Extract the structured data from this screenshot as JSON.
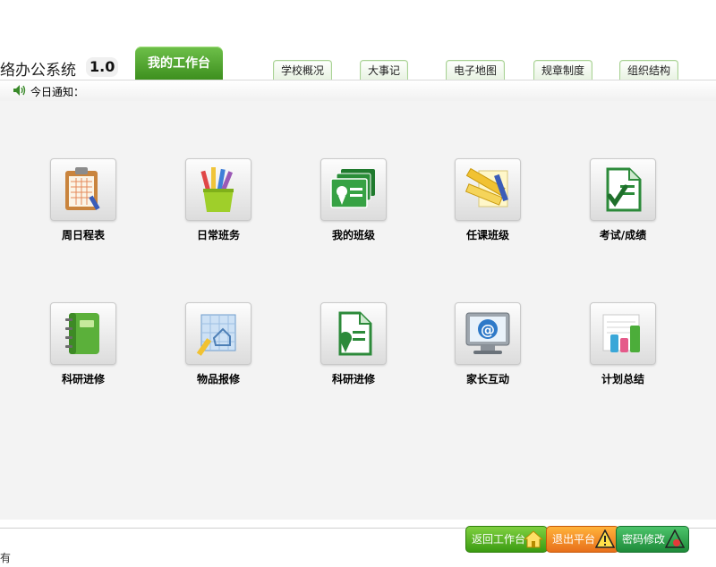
{
  "header": {
    "app_title": "络办公系统",
    "app_version": "1.0",
    "active_tab": "我的工作台",
    "nav_tabs": [
      "学校概况",
      "大事记",
      "电子地图",
      "规章制度",
      "组织结构"
    ]
  },
  "notice": {
    "label": "今日通知："
  },
  "apps": [
    {
      "label": "周日程表",
      "icon": "clipboard-schedule-icon"
    },
    {
      "label": "日常班务",
      "icon": "pencil-cup-icon"
    },
    {
      "label": "我的班级",
      "icon": "class-cards-icon"
    },
    {
      "label": "任课班级",
      "icon": "ruler-notes-icon"
    },
    {
      "label": "考试/成绩",
      "icon": "exam-check-icon"
    },
    {
      "label": "科研进修",
      "icon": "green-notebook-icon"
    },
    {
      "label": "物品报修",
      "icon": "blueprint-icon"
    },
    {
      "label": "科研进修",
      "icon": "certificate-icon"
    },
    {
      "label": "家长互动",
      "icon": "monitor-at-icon"
    },
    {
      "label": "计划总结",
      "icon": "bar-report-icon"
    }
  ],
  "footer": {
    "status_text": "有",
    "buttons": [
      {
        "label": "返回工作台",
        "icon": "home-icon"
      },
      {
        "label": "退出平台",
        "icon": "warning-icon"
      },
      {
        "label": "密码修改",
        "icon": "key-warning-icon"
      }
    ]
  },
  "colors": {
    "accent_green": "#3c8e1d",
    "tab_border": "#a9d295",
    "exit_orange": "#e8701b",
    "main_bg": "#f3f3f3"
  }
}
